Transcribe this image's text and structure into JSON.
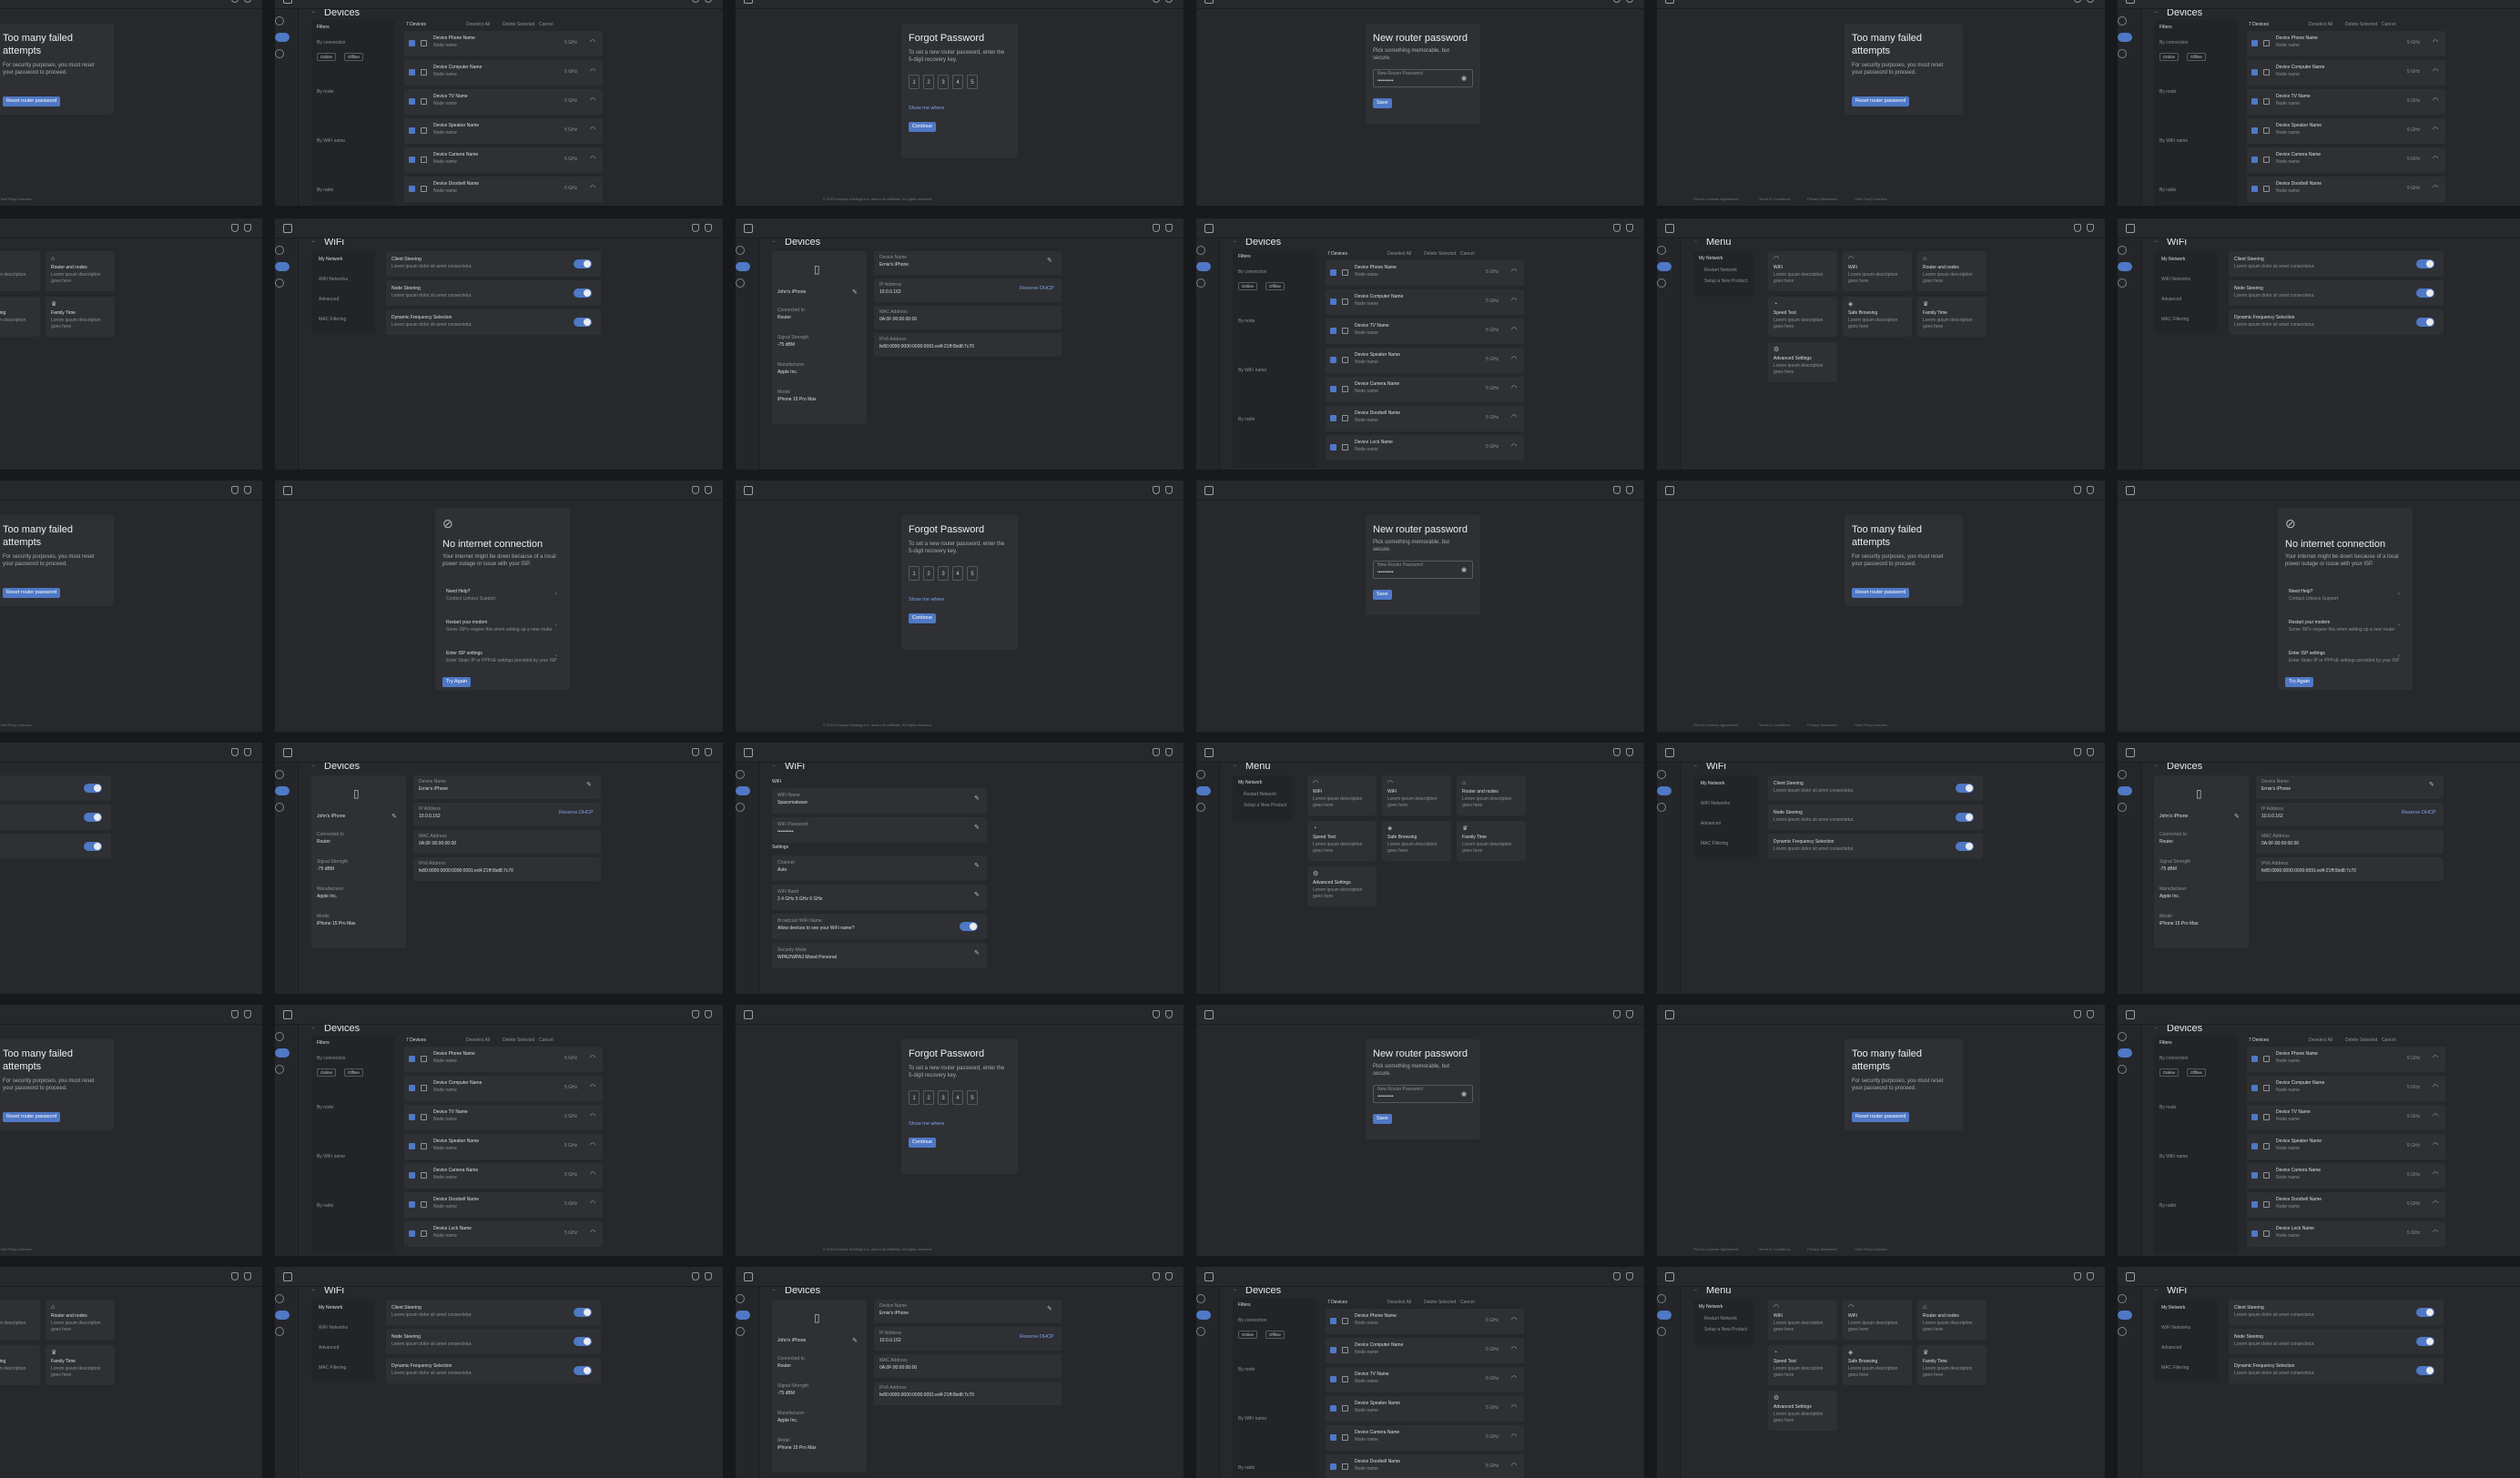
{
  "login": {
    "title": "Too many failed attempts",
    "body": "For security purposes, you must reset your password to proceed.",
    "button": "Reset router password",
    "footer_short": [
      "Put info License Agreement",
      "Terms & Conditions",
      "Privacy Statement",
      "Third Party Licenses"
    ],
    "copyright": "© 2023 Linksys Holdings Inc. and/or its affiliates. All rights reserved."
  },
  "forgot": {
    "title": "Forgot Password",
    "body": "To set a new router password, enter the 5-digit recovery key.",
    "digits": [
      "1",
      "2",
      "3",
      "4",
      "5"
    ],
    "link": "Show me where",
    "button": "Continue"
  },
  "newpw": {
    "title": "New router password",
    "body": "Pick something memorable, but secure.",
    "label": "New Router Password",
    "value": "••••••••••",
    "button": "Save"
  },
  "nointernet": {
    "title": "No internet connection",
    "body": "Your internet might be down because of a local power outage or issue with your ISP.",
    "items": [
      {
        "t": "Need Help?",
        "s": "Contact Linksys Support"
      },
      {
        "t": "Restart your modem",
        "s": "Some ISPs require this when setting up a new router"
      },
      {
        "t": "Enter ISP settings",
        "s": "Enter Static IP or PPPoE settings provided by your ISP"
      }
    ],
    "button": "Try Again"
  },
  "menu": {
    "title": "Menu",
    "side": {
      "title": "My Network",
      "items": [
        "Restart Network",
        "Setup a New Product"
      ]
    },
    "cards": [
      {
        "t": "WiFi",
        "d": "Lorem ipsum description goes here"
      },
      {
        "t": "WiFi",
        "d": "Lorem ipsum description goes here"
      },
      {
        "t": "Router and nodes",
        "d": "Lorem ipsum description goes here"
      },
      {
        "t": "Speed Test",
        "d": "Lorem ipsum description goes here"
      },
      {
        "t": "Safe Browsing",
        "d": "Lorem ipsum description goes here"
      },
      {
        "t": "Family Time",
        "d": "Lorem ipsum description goes here"
      },
      {
        "t": "Advanced Settings",
        "d": "Lorem ipsum description goes here"
      }
    ]
  },
  "wifi": {
    "title": "WiFi",
    "side": [
      "My Network",
      "WiFi Networks",
      "Advanced",
      "MAC Filtering"
    ],
    "settings": [
      {
        "t": "Client Steering",
        "d": "Lorem ipsum dolor sit amet consectetur."
      },
      {
        "t": "Node Steering",
        "d": "Lorem ipsum dolor sit amet consectetur."
      },
      {
        "t": "Dynamic Frequency Selection",
        "d": "Lorem ipsum dolor sit amet consectetur."
      }
    ],
    "detail": {
      "section": "WiFi",
      "rows": [
        {
          "t": "WiFi Name",
          "v": "Spacemalware"
        },
        {
          "t": "WiFi Password",
          "v": "••••••••••"
        },
        {
          "t": "Channel",
          "v": "Auto"
        },
        {
          "t": "WiFi Band",
          "v": "2.4 GHz   5 GHz   6 GHz"
        },
        {
          "t": "Broadcast WiFi Name",
          "v": "Allow devices to see your WiFi name?"
        },
        {
          "t": "Security Mode",
          "v": "WPA2/WPA3 Mixed Personal"
        }
      ],
      "subsection": "Settings"
    }
  },
  "devices": {
    "title": "Devices",
    "filters": {
      "title": "Filters",
      "groups": [
        "By connection",
        "By node",
        "By WiFi name",
        "By radio"
      ],
      "chips": [
        "Online",
        "Offline"
      ]
    },
    "count": "7 Devices",
    "actions": [
      "Deselect All",
      "Delete Selected",
      "Cancel"
    ],
    "items": [
      {
        "t": "Device Phone Name",
        "s": "Node name",
        "b": "5 GHz"
      },
      {
        "t": "Device Computer Name",
        "s": "Node name",
        "b": "5 GHz"
      },
      {
        "t": "Device TV Name",
        "s": "Node name",
        "b": "5 GHz"
      },
      {
        "t": "Device Speaker Name",
        "s": "Node name",
        "b": "5 GHz"
      },
      {
        "t": "Device Camera Name",
        "s": "Node name",
        "b": "5 GHz"
      },
      {
        "t": "Device Doorbell Name",
        "s": "Node name",
        "b": "5 GHz"
      },
      {
        "t": "Device Lock Name",
        "s": "Node name",
        "b": "5 GHz"
      }
    ],
    "detail": {
      "name": "John's iPhone",
      "connected_to_label": "Connected to",
      "connected_to": "Router",
      "signal_label": "Signal Strength",
      "signal": "-75 dBM",
      "manufacturer_label": "Manufacturer",
      "manufacturer": "Apple Inc.",
      "model_label": "Model",
      "model": "iPhone 15 Pro Max",
      "fields": [
        {
          "t": "Device Name",
          "v": "Ernie's iPhone"
        },
        {
          "t": "IP Address",
          "v": "10.0.0.162",
          "x": "Reserve DHCP"
        },
        {
          "t": "MAC Address",
          "v": "0A:0F:00:00:00:00"
        },
        {
          "t": "IPv6 Address",
          "v": "fe80:0000:0000:0000:0091:ed4:21ff:0bd8:7c70"
        }
      ]
    }
  }
}
